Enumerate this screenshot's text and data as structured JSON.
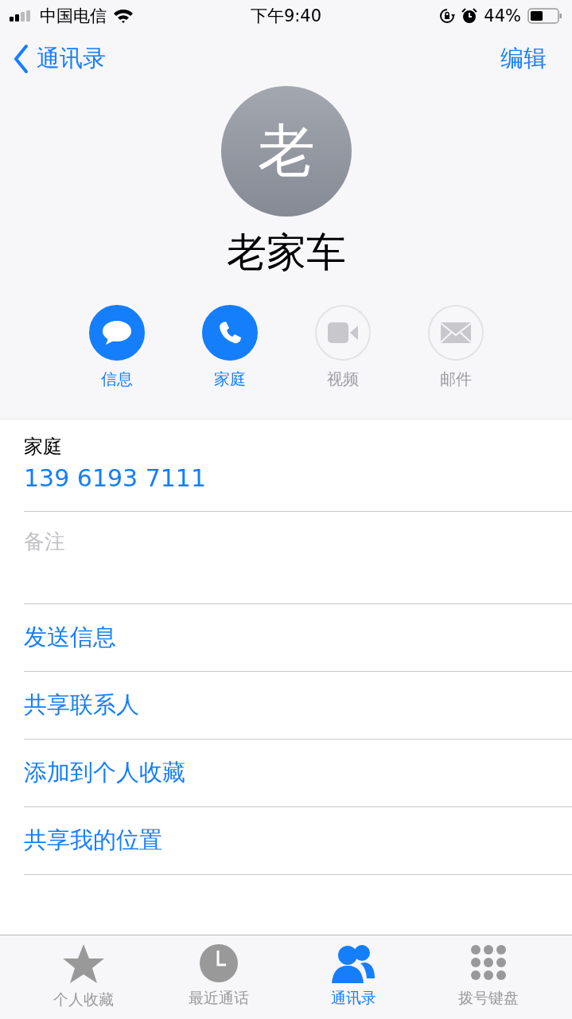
{
  "status_bar": {
    "carrier": "中国电信",
    "time": "下午9:40",
    "battery": "44%"
  },
  "nav": {
    "back": "通讯录",
    "edit": "编辑"
  },
  "contact": {
    "initial": "老",
    "name": "老家车"
  },
  "actions": [
    {
      "kind": "message",
      "label": "信息",
      "enabled": true
    },
    {
      "kind": "phone",
      "label": "家庭",
      "enabled": true
    },
    {
      "kind": "video",
      "label": "视频",
      "enabled": false
    },
    {
      "kind": "mail",
      "label": "邮件",
      "enabled": false
    }
  ],
  "phone": {
    "label": "家庭",
    "number": "139 6193 7111"
  },
  "notes": {
    "placeholder": "备注"
  },
  "links": [
    "发送信息",
    "共享联系人",
    "添加到个人收藏",
    "共享我的位置"
  ],
  "tabs": [
    {
      "kind": "star",
      "label": "个人收藏",
      "selected": false
    },
    {
      "kind": "clock",
      "label": "最近通话",
      "selected": false
    },
    {
      "kind": "contacts",
      "label": "通讯录",
      "selected": true
    },
    {
      "kind": "keypad",
      "label": "拨号键盘",
      "selected": false
    }
  ]
}
